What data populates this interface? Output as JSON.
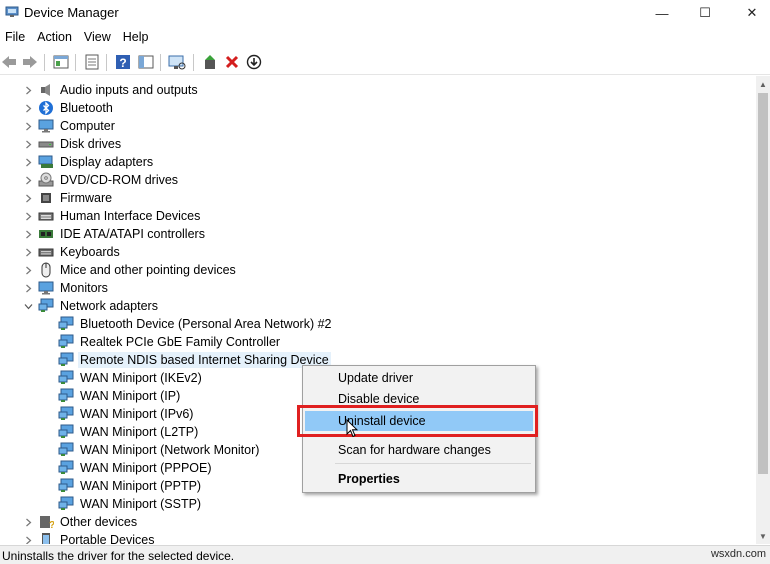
{
  "window": {
    "title": "Device Manager",
    "minimize": "—",
    "maximize": "☐",
    "close": "✕"
  },
  "menu": [
    "File",
    "Action",
    "View",
    "Help"
  ],
  "tree": {
    "categories": [
      {
        "label": "Audio inputs and outputs",
        "icon": "speaker-icon",
        "expanded": false
      },
      {
        "label": "Bluetooth",
        "icon": "bluetooth-icon",
        "expanded": false
      },
      {
        "label": "Computer",
        "icon": "monitor-icon",
        "expanded": false
      },
      {
        "label": "Disk drives",
        "icon": "disk-drive-icon",
        "expanded": false
      },
      {
        "label": "Display adapters",
        "icon": "display-adapter-icon",
        "expanded": false
      },
      {
        "label": "DVD/CD-ROM drives",
        "icon": "dvd-drive-icon",
        "expanded": false
      },
      {
        "label": "Firmware",
        "icon": "firmware-icon",
        "expanded": false
      },
      {
        "label": "Human Interface Devices",
        "icon": "hid-icon",
        "expanded": false
      },
      {
        "label": "IDE ATA/ATAPI controllers",
        "icon": "ide-controller-icon",
        "expanded": false
      },
      {
        "label": "Keyboards",
        "icon": "keyboard-icon",
        "expanded": false
      },
      {
        "label": "Mice and other pointing devices",
        "icon": "mouse-icon",
        "expanded": false
      },
      {
        "label": "Monitors",
        "icon": "monitor-icon",
        "expanded": false
      },
      {
        "label": "Network adapters",
        "icon": "network-adapter-icon",
        "expanded": true
      }
    ],
    "network_children": [
      "Bluetooth Device (Personal Area Network) #2",
      "Realtek PCIe GbE Family Controller",
      "Remote NDIS based Internet Sharing Device",
      "WAN Miniport (IKEv2)",
      "WAN Miniport (IP)",
      "WAN Miniport (IPv6)",
      "WAN Miniport (L2TP)",
      "WAN Miniport (Network Monitor)",
      "WAN Miniport (PPPOE)",
      "WAN Miniport (PPTP)",
      "WAN Miniport (SSTP)"
    ],
    "selected_child": "Remote NDIS based Internet Sharing Device",
    "after": [
      {
        "label": "Other devices",
        "icon": "unknown-device-icon",
        "expanded": false
      },
      {
        "label": "Portable Devices",
        "icon": "portable-device-icon",
        "expanded": false
      }
    ]
  },
  "context_menu": {
    "update": "Update driver",
    "disable": "Disable device",
    "uninstall": "Uninstall device",
    "scan": "Scan for hardware changes",
    "properties": "Properties"
  },
  "status": {
    "text": "Uninstalls the driver for the selected device.",
    "watermark": "wsxdn.com"
  },
  "colors": {
    "highlight": "#91c9f7",
    "selection": "#e5f1fb",
    "annotation": "#e02020"
  }
}
